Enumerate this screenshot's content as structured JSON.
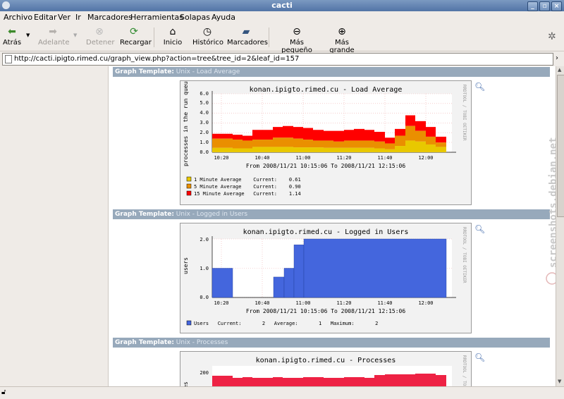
{
  "window": {
    "title": "cacti"
  },
  "menu": [
    "Archivo",
    "Editar",
    "Ver",
    "Ir",
    "Marcadores",
    "Herramientas",
    "Solapas",
    "Ayuda"
  ],
  "toolbar": {
    "back": "Atrás",
    "forward": "Adelante",
    "stop": "Detener",
    "reload": "Recargar",
    "home": "Inicio",
    "history": "Histórico",
    "bookmarks": "Marcadores",
    "smaller": "Más pequeño",
    "bigger": "Más grande"
  },
  "url": "http://cacti.ipigto.rimed.cu/graph_view.php?action=tree&tree_id=2&leaf_id=157",
  "watermark": "screenshots.debian.net",
  "sections": [
    {
      "label": "Graph Template:",
      "name": "Unix - Load Average"
    },
    {
      "label": "Graph Template:",
      "name": "Unix - Logged in Users"
    },
    {
      "label": "Graph Template:",
      "name": "Unix - Processes"
    }
  ],
  "rrd_credit": "RRDTOOL / TOBI OETIKER",
  "graphs": {
    "load": {
      "title": "konan.ipigto.rimed.cu - Load Average",
      "ylabel": "processes in the run queue",
      "yticks": [
        "0.0",
        "1.0",
        "2.0",
        "3.0",
        "4.0",
        "5.0",
        "6.0"
      ],
      "xticks": [
        "10:20",
        "10:40",
        "11:00",
        "11:20",
        "11:40",
        "12:00"
      ],
      "period": "From 2008/11/21 10:15:06 To 2008/11/21 12:15:06",
      "legend": [
        {
          "swatch": "#e8c800",
          "text": "1 Minute Average    Current:    0.61"
        },
        {
          "swatch": "#ea8f00",
          "text": "5 Minute Average    Current:    0.90"
        },
        {
          "swatch": "#ff0000",
          "text": "15 Minute Average   Current:    1.14"
        }
      ]
    },
    "users": {
      "title": "konan.ipigto.rimed.cu - Logged in Users",
      "ylabel": "users",
      "yticks": [
        "0.0",
        "1.0",
        "2.0"
      ],
      "xticks": [
        "10:20",
        "10:40",
        "11:00",
        "11:20",
        "11:40",
        "12:00"
      ],
      "period": "From 2008/11/21 10:15:06 To 2008/11/21 12:15:06",
      "legend": "Users   Current:       2   Average:       1   Maximum:       2"
    },
    "procs": {
      "title": "konan.ipigto.rimed.cu - Processes",
      "ytick": "200",
      "ylabel": "es"
    }
  },
  "colors": {
    "yellow": "#e8c800",
    "orange": "#ea8f00",
    "red": "#ff0000",
    "blue": "#4466dd"
  }
}
